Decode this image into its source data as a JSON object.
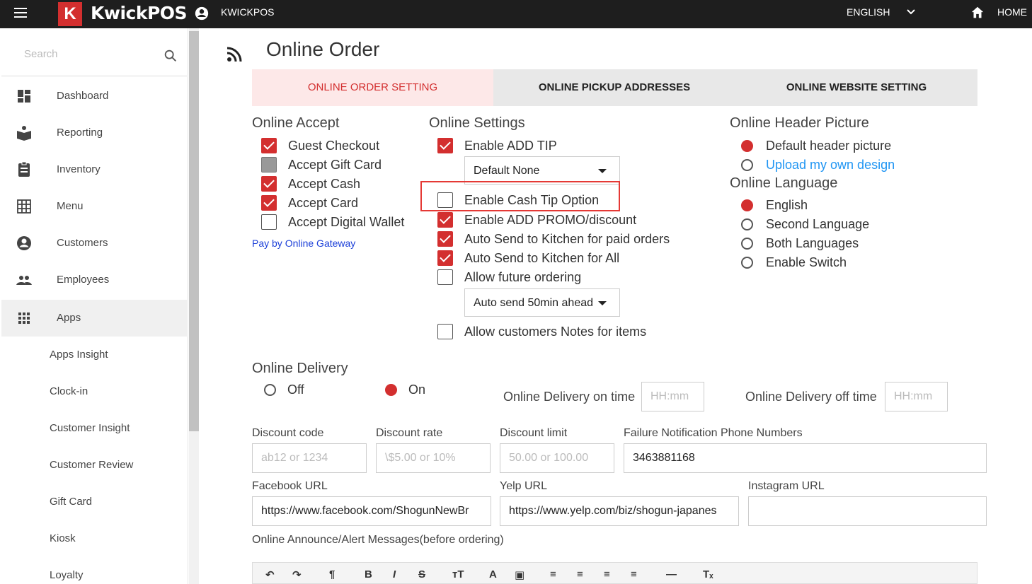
{
  "header": {
    "brand_letter": "K",
    "brand": "KwickPOS",
    "user": "KWICKPOS",
    "language": "ENGLISH",
    "home": "HOME"
  },
  "sidebar": {
    "search_placeholder": "Search",
    "items": [
      {
        "label": "Dashboard",
        "icon": "dashboard-icon"
      },
      {
        "label": "Reporting",
        "icon": "reporting-icon"
      },
      {
        "label": "Inventory",
        "icon": "inventory-icon"
      },
      {
        "label": "Menu",
        "icon": "grid-icon"
      },
      {
        "label": "Customers",
        "icon": "account-icon"
      },
      {
        "label": "Employees",
        "icon": "people-icon"
      },
      {
        "label": "Apps",
        "icon": "apps-icon"
      }
    ],
    "sub_items": [
      "Apps Insight",
      "Clock-in",
      "Customer Insight",
      "Customer Review",
      "Gift Card",
      "Kiosk",
      "Loyalty"
    ]
  },
  "page": {
    "title": "Online Order",
    "tabs": [
      "ONLINE ORDER SETTING",
      "ONLINE PICKUP ADDRESSES",
      "ONLINE WEBSITE SETTING"
    ]
  },
  "online_accept": {
    "title": "Online Accept",
    "items": [
      {
        "label": "Guest Checkout",
        "state": "checked"
      },
      {
        "label": "Accept Gift Card",
        "state": "disabled"
      },
      {
        "label": "Accept Cash",
        "state": "checked"
      },
      {
        "label": "Accept Card",
        "state": "checked"
      },
      {
        "label": "Accept Digital Wallet",
        "state": "unchecked"
      }
    ],
    "pay_link": "Pay by Online Gateway"
  },
  "online_settings": {
    "title": "Online Settings",
    "enable_tip": "Enable ADD TIP",
    "tip_select": "Default None",
    "cash_tip": "Enable Cash Tip Option",
    "promo": "Enable ADD PROMO/discount",
    "auto_paid": "Auto Send to Kitchen for paid orders",
    "auto_all": "Auto Send to Kitchen for All",
    "future": "Allow future ordering",
    "future_select": "Auto send 50min ahead",
    "notes": "Allow customers Notes for items"
  },
  "header_picture": {
    "title": "Online Header Picture",
    "default": "Default header picture",
    "upload": "Upload my own design"
  },
  "language_section": {
    "title": "Online Language",
    "options": [
      "English",
      "Second Language",
      "Both Languages",
      "Enable Switch"
    ]
  },
  "delivery": {
    "title": "Online Delivery",
    "off": "Off",
    "on": "On",
    "on_time_label": "Online Delivery on time",
    "off_time_label": "Online Delivery off time",
    "time_placeholder": "HH:mm"
  },
  "discount": {
    "code_label": "Discount code",
    "code_placeholder": "ab12 or 1234",
    "rate_label": "Discount rate",
    "rate_placeholder": "\\$5.00 or 10%",
    "limit_label": "Discount limit",
    "limit_placeholder": "50.00 or 100.00",
    "phone_label": "Failure Notification Phone Numbers",
    "phone_value": "3463881168"
  },
  "social": {
    "facebook_label": "Facebook URL",
    "facebook_value": "https://www.facebook.com/ShogunNewBr",
    "yelp_label": "Yelp URL",
    "yelp_value": "https://www.yelp.com/biz/shogun-japanes",
    "instagram_label": "Instagram URL",
    "instagram_value": ""
  },
  "announce_label": "Online Announce/Alert Messages(before ordering)",
  "colors": {
    "accent": "#d32f2f",
    "topbar": "#1e1e1e",
    "link": "#2196f3"
  }
}
